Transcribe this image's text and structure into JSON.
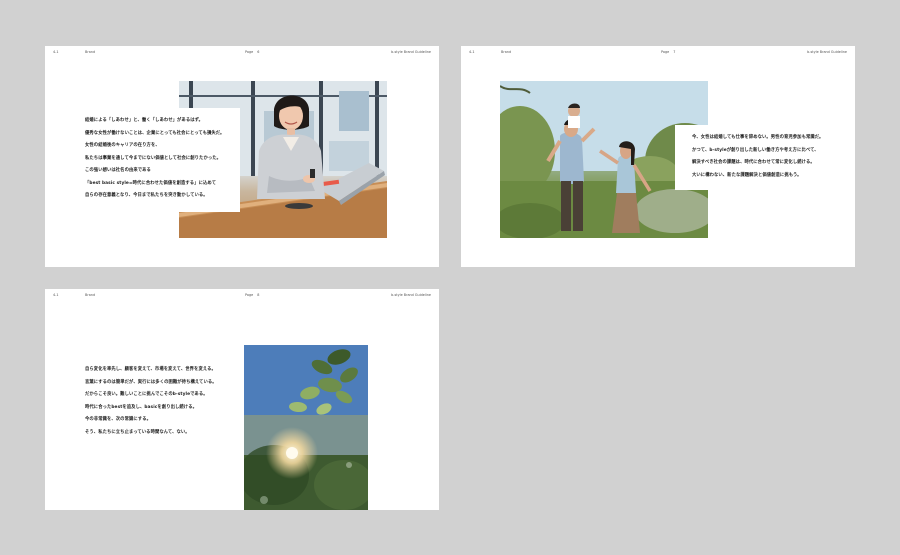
{
  "slides": [
    {
      "number": "4-1",
      "section": "Brand",
      "page_label": "Page",
      "page_number": "6",
      "guideline_title": "b-style Brand Guideline",
      "lines": [
        "結婚による「しあわせ」と、働く「しあわせ」があるはず。",
        "優秀な女性が働けないことは、企業にとっても社会にとっても損失だ。",
        "女性の結婚後のキャリアの在り方を、",
        "私たちは事業を通して今までにない価値として社会に創りたかった。",
        "この強い想いは社名の由来である",
        "「best basic style=時代に合わせた価値を創造する」に込めて",
        "自らの存在意義となり、今日まで私たちを突き動かしている。"
      ]
    },
    {
      "number": "4-1",
      "section": "Brand",
      "page_label": "Page",
      "page_number": "7",
      "guideline_title": "b-style Brand Guideline",
      "lines": [
        "今、女性は結婚しても仕事を辞めない。男性の育児参加も常識だ。",
        "かつて、b-styleが創り出した新しい働き方や考え方に比べて、",
        "解決すべき社会の課題は、時代に合わせて常に変化し続ける。",
        "大いに構わない、新たな課題解決と価値創造に挑もう。"
      ]
    },
    {
      "number": "4-1",
      "section": "Brand",
      "page_label": "Page",
      "page_number": "8",
      "guideline_title": "b-style Brand Guideline",
      "lines": [
        "自ら変化を率先し、顧客を変えて、市場を変えて、世界を変える。",
        "言葉にするのは簡単だが、実行には多くの困難が待ち構えている。",
        "だからこそ良い。難しいことに挑んでこそのb-styleである。",
        "時代に合ったbestを追及し、basicを創り出し続ける。",
        "今の非常識を、次の常識にする。",
        "そう、私たちに立ち止まっている時間なんて、ない。"
      ]
    }
  ]
}
